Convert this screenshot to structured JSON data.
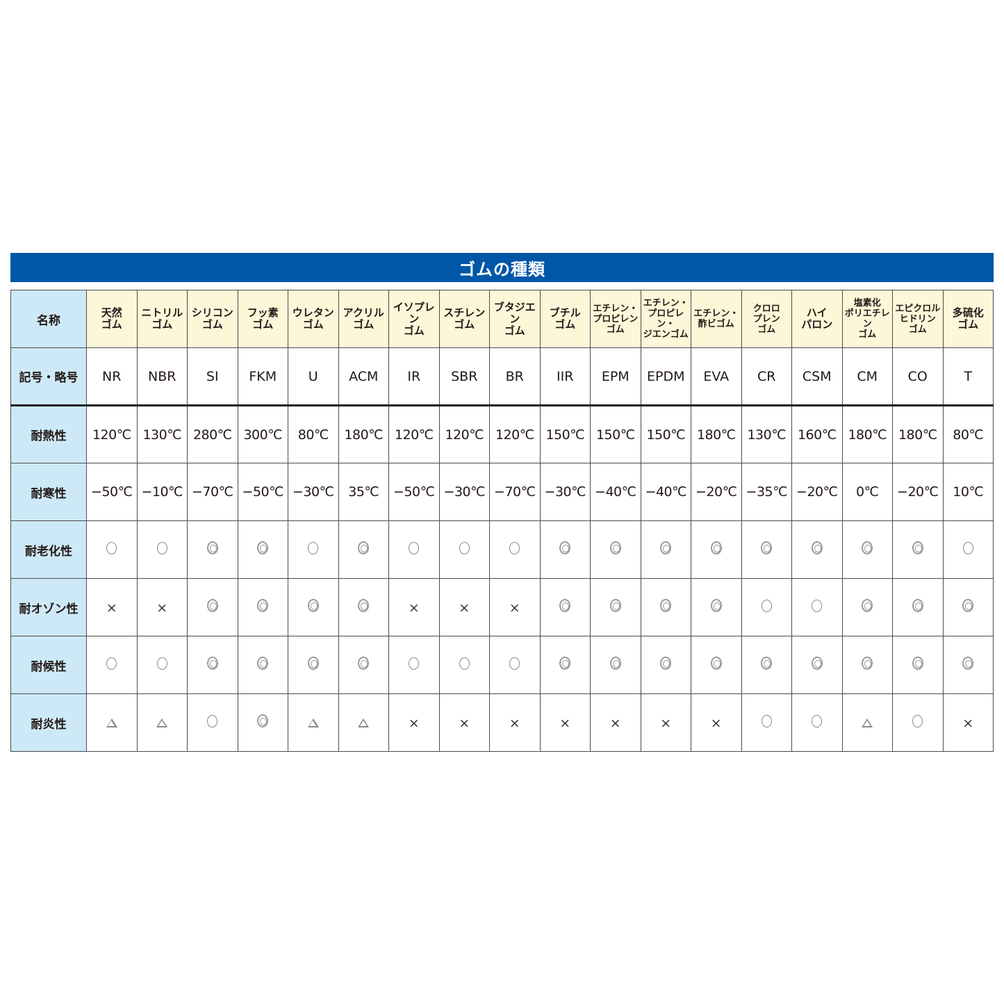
{
  "title": "ゴムの種類",
  "row_labels": {
    "name": "名称",
    "abbr": "記号・略号",
    "heat": "耐熱性",
    "cold": "耐寒性",
    "aging": "耐老化性",
    "ozone": "耐オゾン性",
    "weather": "耐候性",
    "flame": "耐炎性"
  },
  "legend_symbols": {
    "excellent": "◎",
    "good": "○",
    "fair": "△",
    "poor": "×"
  },
  "rubbers": [
    {
      "name": "天然\nゴム",
      "abbr": "NR",
      "heat": "120℃",
      "cold": "−50℃",
      "aging": "good",
      "ozone": "poor",
      "weather": "good",
      "flame": "fair"
    },
    {
      "name": "ニトリル\nゴム",
      "abbr": "NBR",
      "heat": "130℃",
      "cold": "−10℃",
      "aging": "good",
      "ozone": "poor",
      "weather": "good",
      "flame": "fair"
    },
    {
      "name": "シリコン\nゴム",
      "abbr": "SI",
      "heat": "280℃",
      "cold": "−70℃",
      "aging": "excellent",
      "ozone": "excellent",
      "weather": "excellent",
      "flame": "good"
    },
    {
      "name": "フッ素\nゴム",
      "abbr": "FKM",
      "heat": "300℃",
      "cold": "−50℃",
      "aging": "excellent",
      "ozone": "excellent",
      "weather": "excellent",
      "flame": "excellent"
    },
    {
      "name": "ウレタン\nゴム",
      "abbr": "U",
      "heat": "80℃",
      "cold": "−30℃",
      "aging": "good",
      "ozone": "excellent",
      "weather": "excellent",
      "flame": "fair"
    },
    {
      "name": "アクリル\nゴム",
      "abbr": "ACM",
      "heat": "180℃",
      "cold": "35℃",
      "aging": "excellent",
      "ozone": "excellent",
      "weather": "excellent",
      "flame": "fair"
    },
    {
      "name": "イソプレン\nゴム",
      "abbr": "IR",
      "heat": "120℃",
      "cold": "−50℃",
      "aging": "good",
      "ozone": "poor",
      "weather": "good",
      "flame": "poor"
    },
    {
      "name": "スチレン\nゴム",
      "abbr": "SBR",
      "heat": "120℃",
      "cold": "−30℃",
      "aging": "good",
      "ozone": "poor",
      "weather": "good",
      "flame": "poor"
    },
    {
      "name": "ブタジエン\nゴム",
      "abbr": "BR",
      "heat": "120℃",
      "cold": "−70℃",
      "aging": "good",
      "ozone": "poor",
      "weather": "good",
      "flame": "poor"
    },
    {
      "name": "ブチル\nゴム",
      "abbr": "IIR",
      "heat": "150℃",
      "cold": "−30℃",
      "aging": "excellent",
      "ozone": "excellent",
      "weather": "excellent",
      "flame": "poor"
    },
    {
      "name": "エチレン・\nプロピレン\nゴム",
      "abbr": "EPM",
      "heat": "150℃",
      "cold": "−40℃",
      "aging": "excellent",
      "ozone": "excellent",
      "weather": "excellent",
      "flame": "poor"
    },
    {
      "name": "エチレン・\nプロピレン・\nジエンゴム",
      "abbr": "EPDM",
      "heat": "150℃",
      "cold": "−40℃",
      "aging": "excellent",
      "ozone": "excellent",
      "weather": "excellent",
      "flame": "poor"
    },
    {
      "name": "エチレン・\n酢ビゴム",
      "abbr": "EVA",
      "heat": "180℃",
      "cold": "−20℃",
      "aging": "excellent",
      "ozone": "excellent",
      "weather": "excellent",
      "flame": "poor"
    },
    {
      "name": "クロロ\nプレン\nゴム",
      "abbr": "CR",
      "heat": "130℃",
      "cold": "−35℃",
      "aging": "excellent",
      "ozone": "good",
      "weather": "excellent",
      "flame": "good"
    },
    {
      "name": "ハイ\nパロン",
      "abbr": "CSM",
      "heat": "160℃",
      "cold": "−20℃",
      "aging": "excellent",
      "ozone": "good",
      "weather": "excellent",
      "flame": "good"
    },
    {
      "name": "塩素化\nポリエチレン\nゴム",
      "abbr": "CM",
      "heat": "180℃",
      "cold": "0℃",
      "aging": "excellent",
      "ozone": "excellent",
      "weather": "excellent",
      "flame": "fair"
    },
    {
      "name": "エピクロル\nヒドリン\nゴム",
      "abbr": "CO",
      "heat": "180℃",
      "cold": "−20℃",
      "aging": "excellent",
      "ozone": "excellent",
      "weather": "excellent",
      "flame": "good"
    },
    {
      "name": "多硫化\nゴム",
      "abbr": "T",
      "heat": "80℃",
      "cold": "10℃",
      "aging": "good",
      "ozone": "excellent",
      "weather": "excellent",
      "flame": "poor"
    }
  ],
  "colors": {
    "title_bar": "#0057a8",
    "row_label_bg": "#cde9f8",
    "name_cell_bg": "#fdf7d9",
    "border": "#4a4a4a"
  }
}
